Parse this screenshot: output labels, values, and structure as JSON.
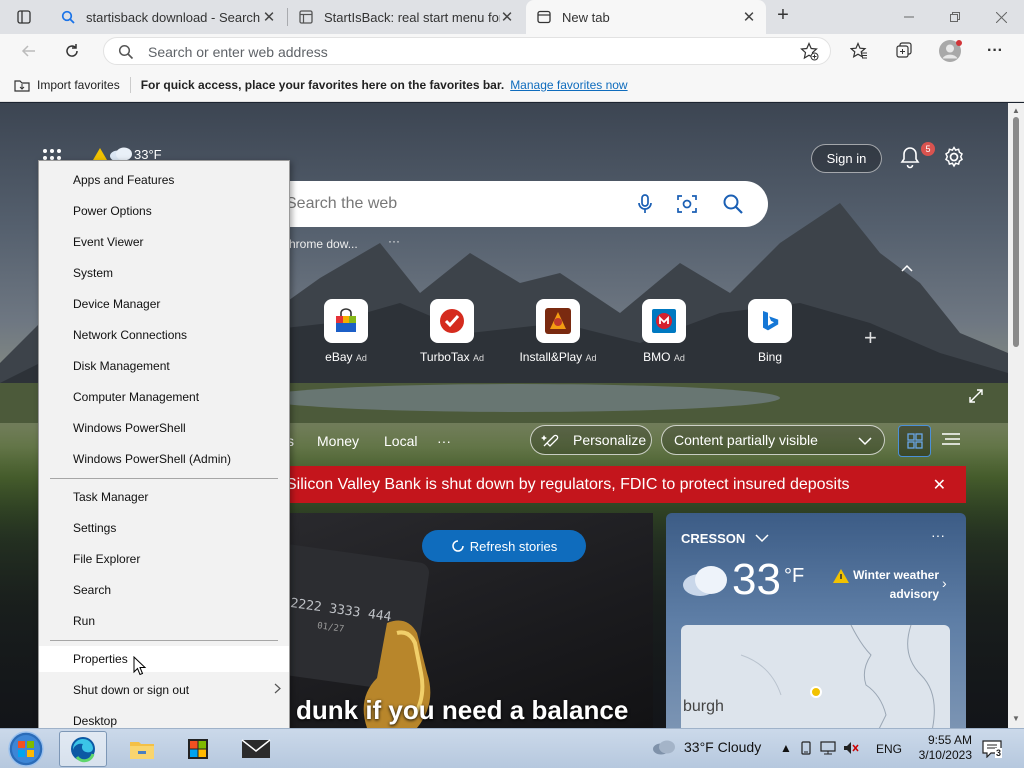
{
  "browser": {
    "tabs": [
      {
        "title": "startisback download - Search",
        "icon": "search-icon",
        "close": "✕"
      },
      {
        "title": "StartIsBack: real start menu for W",
        "icon": "page-icon",
        "close": "✕"
      },
      {
        "title": "New tab",
        "icon": "newtab-icon",
        "close": "✕"
      }
    ],
    "new_tab": "+",
    "address_placeholder": "Search or enter web address"
  },
  "favorites_bar": {
    "import_label": "Import favorites",
    "message": "For quick access, place your favorites here on the favorites bar.",
    "link": "Manage favorites now"
  },
  "newtab": {
    "weather_temp": "33°F",
    "sign_in": "Sign in",
    "notification_count": "5",
    "search_placeholder": "Search the web",
    "trending": "chrome dow...",
    "quick_links": [
      {
        "label": "eBay",
        "ad": "Ad",
        "icon": "ebay-icon"
      },
      {
        "label": "TurboTax",
        "ad": "Ad",
        "icon": "turbotax-icon"
      },
      {
        "label": "Install&Play",
        "ad": "Ad",
        "icon": "installplay-icon"
      },
      {
        "label": "BMO",
        "ad": "Ad",
        "icon": "bmo-icon"
      },
      {
        "label": "Bing",
        "ad": "",
        "icon": "bing-icon"
      }
    ],
    "feed_nav": {
      "partial": "s",
      "items": [
        "Money",
        "Local"
      ],
      "more": "···"
    },
    "personalize": "Personalize",
    "content_visibility": "Content partially visible",
    "breaking_news": "Silicon Valley Bank is shut down by regulators, FDIC to protect insured deposits",
    "refresh_stories": "Refresh stories",
    "story_title": "dunk if you need a balance",
    "card_number": "2222 3333 444",
    "card_expiry": "01/27",
    "weather_card": {
      "location": "CRESSON",
      "temp": "33",
      "unit": "°F",
      "alert": "Winter weather advisory",
      "map_city": "burgh"
    }
  },
  "context_menu": {
    "groups": [
      [
        "Apps and Features",
        "Power Options",
        "Event Viewer",
        "System",
        "Device Manager",
        "Network Connections",
        "Disk Management",
        "Computer Management",
        "Windows PowerShell",
        "Windows PowerShell (Admin)"
      ],
      [
        "Task Manager",
        "Settings",
        "File Explorer",
        "Search",
        "Run"
      ],
      [
        "Properties",
        "Shut down or sign out",
        "Desktop"
      ]
    ],
    "highlighted": "Properties"
  },
  "taskbar": {
    "weather": "33°F  Cloudy",
    "language": "ENG",
    "time": "9:55 AM",
    "date": "3/10/2023",
    "notifications": "3"
  }
}
